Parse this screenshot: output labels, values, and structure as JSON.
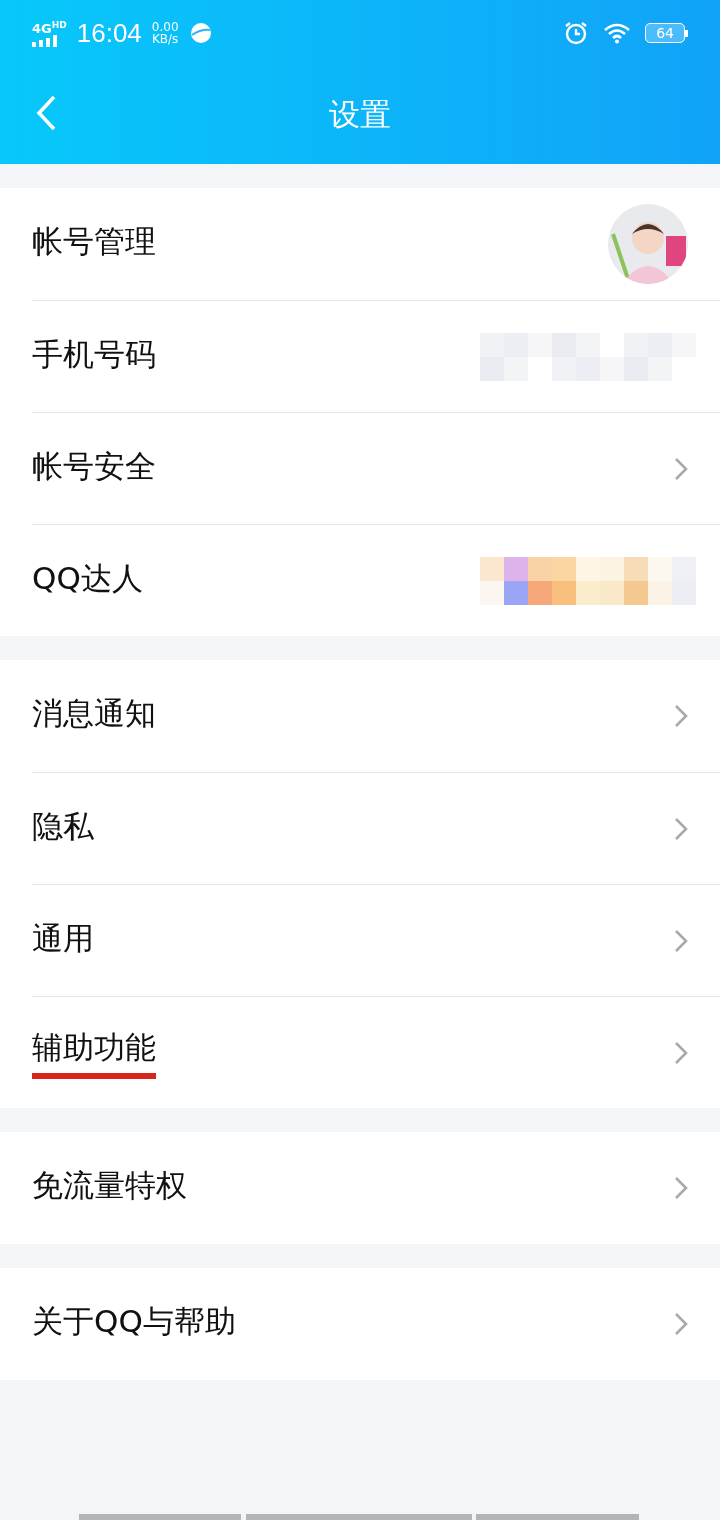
{
  "status_bar": {
    "network": "4G",
    "network_badge": "HD",
    "time": "16:04",
    "speed_value": "0.00",
    "speed_unit": "KB/s",
    "battery": "64"
  },
  "header": {
    "title": "设置"
  },
  "groups": [
    {
      "items": [
        {
          "label": "帐号管理",
          "kind": "avatar",
          "underlined": false
        },
        {
          "label": "手机号码",
          "kind": "redacted",
          "underlined": false
        },
        {
          "label": "帐号安全",
          "kind": "chevron",
          "underlined": false
        },
        {
          "label": "QQ达人",
          "kind": "redacted_color",
          "underlined": false
        }
      ]
    },
    {
      "items": [
        {
          "label": "消息通知",
          "kind": "chevron",
          "underlined": false
        },
        {
          "label": "隐私",
          "kind": "chevron",
          "underlined": false
        },
        {
          "label": "通用",
          "kind": "chevron",
          "underlined": false
        },
        {
          "label": "辅助功能",
          "kind": "chevron",
          "underlined": true
        }
      ]
    },
    {
      "items": [
        {
          "label": "免流量特权",
          "kind": "chevron",
          "underlined": false
        }
      ]
    },
    {
      "items": [
        {
          "label": "关于QQ与帮助",
          "kind": "chevron",
          "underlined": false
        }
      ]
    }
  ]
}
